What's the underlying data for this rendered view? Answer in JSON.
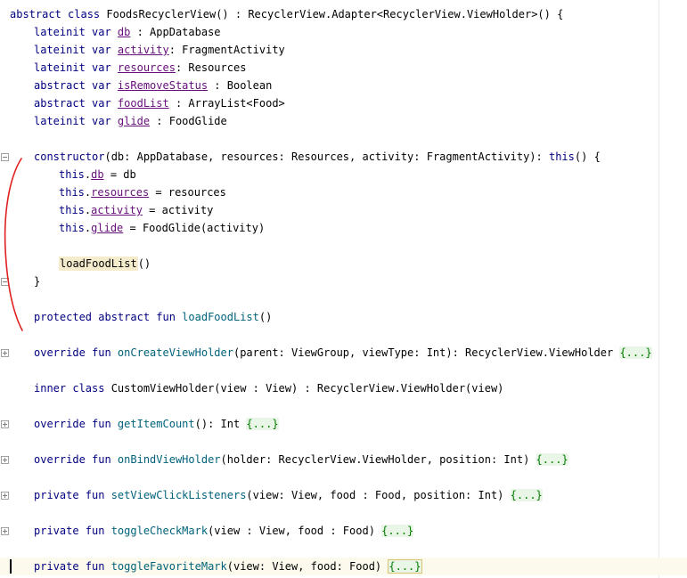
{
  "code": {
    "lines": [
      {
        "indent": 0,
        "tokens": [
          {
            "t": "abstract class ",
            "c": "kw"
          },
          {
            "t": "FoodsRecyclerView() : RecyclerView.Adapter<RecyclerView.ViewHolder>() {",
            "c": ""
          }
        ]
      },
      {
        "indent": 1,
        "tokens": [
          {
            "t": "lateinit var ",
            "c": "kw"
          },
          {
            "t": "db",
            "c": "fld"
          },
          {
            "t": " : AppDatabase",
            "c": ""
          }
        ]
      },
      {
        "indent": 1,
        "tokens": [
          {
            "t": "lateinit var ",
            "c": "kw"
          },
          {
            "t": "activity",
            "c": "fld"
          },
          {
            "t": ": FragmentActivity",
            "c": ""
          }
        ]
      },
      {
        "indent": 1,
        "tokens": [
          {
            "t": "lateinit var ",
            "c": "kw"
          },
          {
            "t": "resources",
            "c": "fld"
          },
          {
            "t": ": Resources",
            "c": ""
          }
        ]
      },
      {
        "indent": 1,
        "tokens": [
          {
            "t": "abstract var ",
            "c": "kw"
          },
          {
            "t": "isRemoveStatus",
            "c": "fld"
          },
          {
            "t": " : Boolean",
            "c": ""
          }
        ]
      },
      {
        "indent": 1,
        "tokens": [
          {
            "t": "abstract var ",
            "c": "kw"
          },
          {
            "t": "foodList",
            "c": "fld"
          },
          {
            "t": " : ArrayList<Food>",
            "c": ""
          }
        ]
      },
      {
        "indent": 1,
        "tokens": [
          {
            "t": "lateinit var ",
            "c": "kw"
          },
          {
            "t": "glide",
            "c": "fld"
          },
          {
            "t": " : FoodGlide",
            "c": ""
          }
        ]
      },
      {
        "indent": 0,
        "tokens": []
      },
      {
        "indent": 1,
        "tokens": [
          {
            "t": "constructor",
            "c": "kw"
          },
          {
            "t": "(db: AppDatabase, resources: Resources, activity: FragmentActivity): ",
            "c": ""
          },
          {
            "t": "this",
            "c": "kw"
          },
          {
            "t": "() {",
            "c": ""
          }
        ]
      },
      {
        "indent": 2,
        "tokens": [
          {
            "t": "this",
            "c": "kw"
          },
          {
            "t": ".",
            "c": ""
          },
          {
            "t": "db",
            "c": "fld"
          },
          {
            "t": " = db",
            "c": ""
          }
        ]
      },
      {
        "indent": 2,
        "tokens": [
          {
            "t": "this",
            "c": "kw"
          },
          {
            "t": ".",
            "c": ""
          },
          {
            "t": "resources",
            "c": "fld"
          },
          {
            "t": " = resources",
            "c": ""
          }
        ]
      },
      {
        "indent": 2,
        "tokens": [
          {
            "t": "this",
            "c": "kw"
          },
          {
            "t": ".",
            "c": ""
          },
          {
            "t": "activity",
            "c": "fld"
          },
          {
            "t": " = activity",
            "c": ""
          }
        ]
      },
      {
        "indent": 2,
        "tokens": [
          {
            "t": "this",
            "c": "kw"
          },
          {
            "t": ".",
            "c": ""
          },
          {
            "t": "glide",
            "c": "fld"
          },
          {
            "t": " = FoodGlide(activity)",
            "c": ""
          }
        ]
      },
      {
        "indent": 0,
        "tokens": []
      },
      {
        "indent": 2,
        "tokens": [
          {
            "t": "loadFoodList",
            "c": "call"
          },
          {
            "t": "()",
            "c": ""
          }
        ]
      },
      {
        "indent": 1,
        "tokens": [
          {
            "t": "}",
            "c": ""
          }
        ]
      },
      {
        "indent": 0,
        "tokens": []
      },
      {
        "indent": 1,
        "tokens": [
          {
            "t": "protected abstract fun ",
            "c": "kw"
          },
          {
            "t": "loadFoodList",
            "c": "fn"
          },
          {
            "t": "()",
            "c": ""
          }
        ]
      },
      {
        "indent": 0,
        "tokens": []
      },
      {
        "indent": 1,
        "tokens": [
          {
            "t": "override fun ",
            "c": "kw"
          },
          {
            "t": "onCreateViewHolder",
            "c": "fn"
          },
          {
            "t": "(parent: ViewGroup, viewType: Int): RecyclerView.ViewHolder ",
            "c": ""
          },
          {
            "t": "{...}",
            "c": "folded"
          }
        ]
      },
      {
        "indent": 0,
        "tokens": []
      },
      {
        "indent": 1,
        "tokens": [
          {
            "t": "inner class ",
            "c": "kw"
          },
          {
            "t": "CustomViewHolder(view : View) : RecyclerView.ViewHolder(view)",
            "c": ""
          }
        ]
      },
      {
        "indent": 0,
        "tokens": []
      },
      {
        "indent": 1,
        "tokens": [
          {
            "t": "override fun ",
            "c": "kw"
          },
          {
            "t": "getItemCount",
            "c": "fn"
          },
          {
            "t": "(): Int ",
            "c": ""
          },
          {
            "t": "{...}",
            "c": "folded"
          }
        ]
      },
      {
        "indent": 0,
        "tokens": []
      },
      {
        "indent": 1,
        "tokens": [
          {
            "t": "override fun ",
            "c": "kw"
          },
          {
            "t": "onBindViewHolder",
            "c": "fn"
          },
          {
            "t": "(holder: RecyclerView.ViewHolder, position: Int) ",
            "c": ""
          },
          {
            "t": "{...}",
            "c": "folded"
          }
        ]
      },
      {
        "indent": 0,
        "tokens": []
      },
      {
        "indent": 1,
        "tokens": [
          {
            "t": "private fun ",
            "c": "kw"
          },
          {
            "t": "setViewClickListeners",
            "c": "fn"
          },
          {
            "t": "(view: View, food : Food, position: Int) ",
            "c": ""
          },
          {
            "t": "{...}",
            "c": "folded"
          }
        ]
      },
      {
        "indent": 0,
        "tokens": []
      },
      {
        "indent": 1,
        "tokens": [
          {
            "t": "private fun ",
            "c": "kw"
          },
          {
            "t": "toggleCheckMark",
            "c": "fn"
          },
          {
            "t": "(view : View, food : Food) ",
            "c": ""
          },
          {
            "t": "{...}",
            "c": "folded"
          }
        ]
      },
      {
        "indent": 0,
        "tokens": []
      },
      {
        "indent": 1,
        "tokens": [
          {
            "t": "private fun ",
            "c": "kw"
          },
          {
            "t": "toggleFavoriteMark",
            "c": "fn"
          },
          {
            "t": "(view: View, food: Food) ",
            "c": ""
          },
          {
            "t": "{...}",
            "c": "folded-sel"
          }
        ]
      }
    ]
  },
  "colors": {
    "keyword": "#000080",
    "field": "#660e7a",
    "function": "#00627a",
    "folded_text": "#007a00",
    "annotation": "#e02020"
  },
  "icons": {
    "fold_marker": "fold-minus-icon"
  }
}
